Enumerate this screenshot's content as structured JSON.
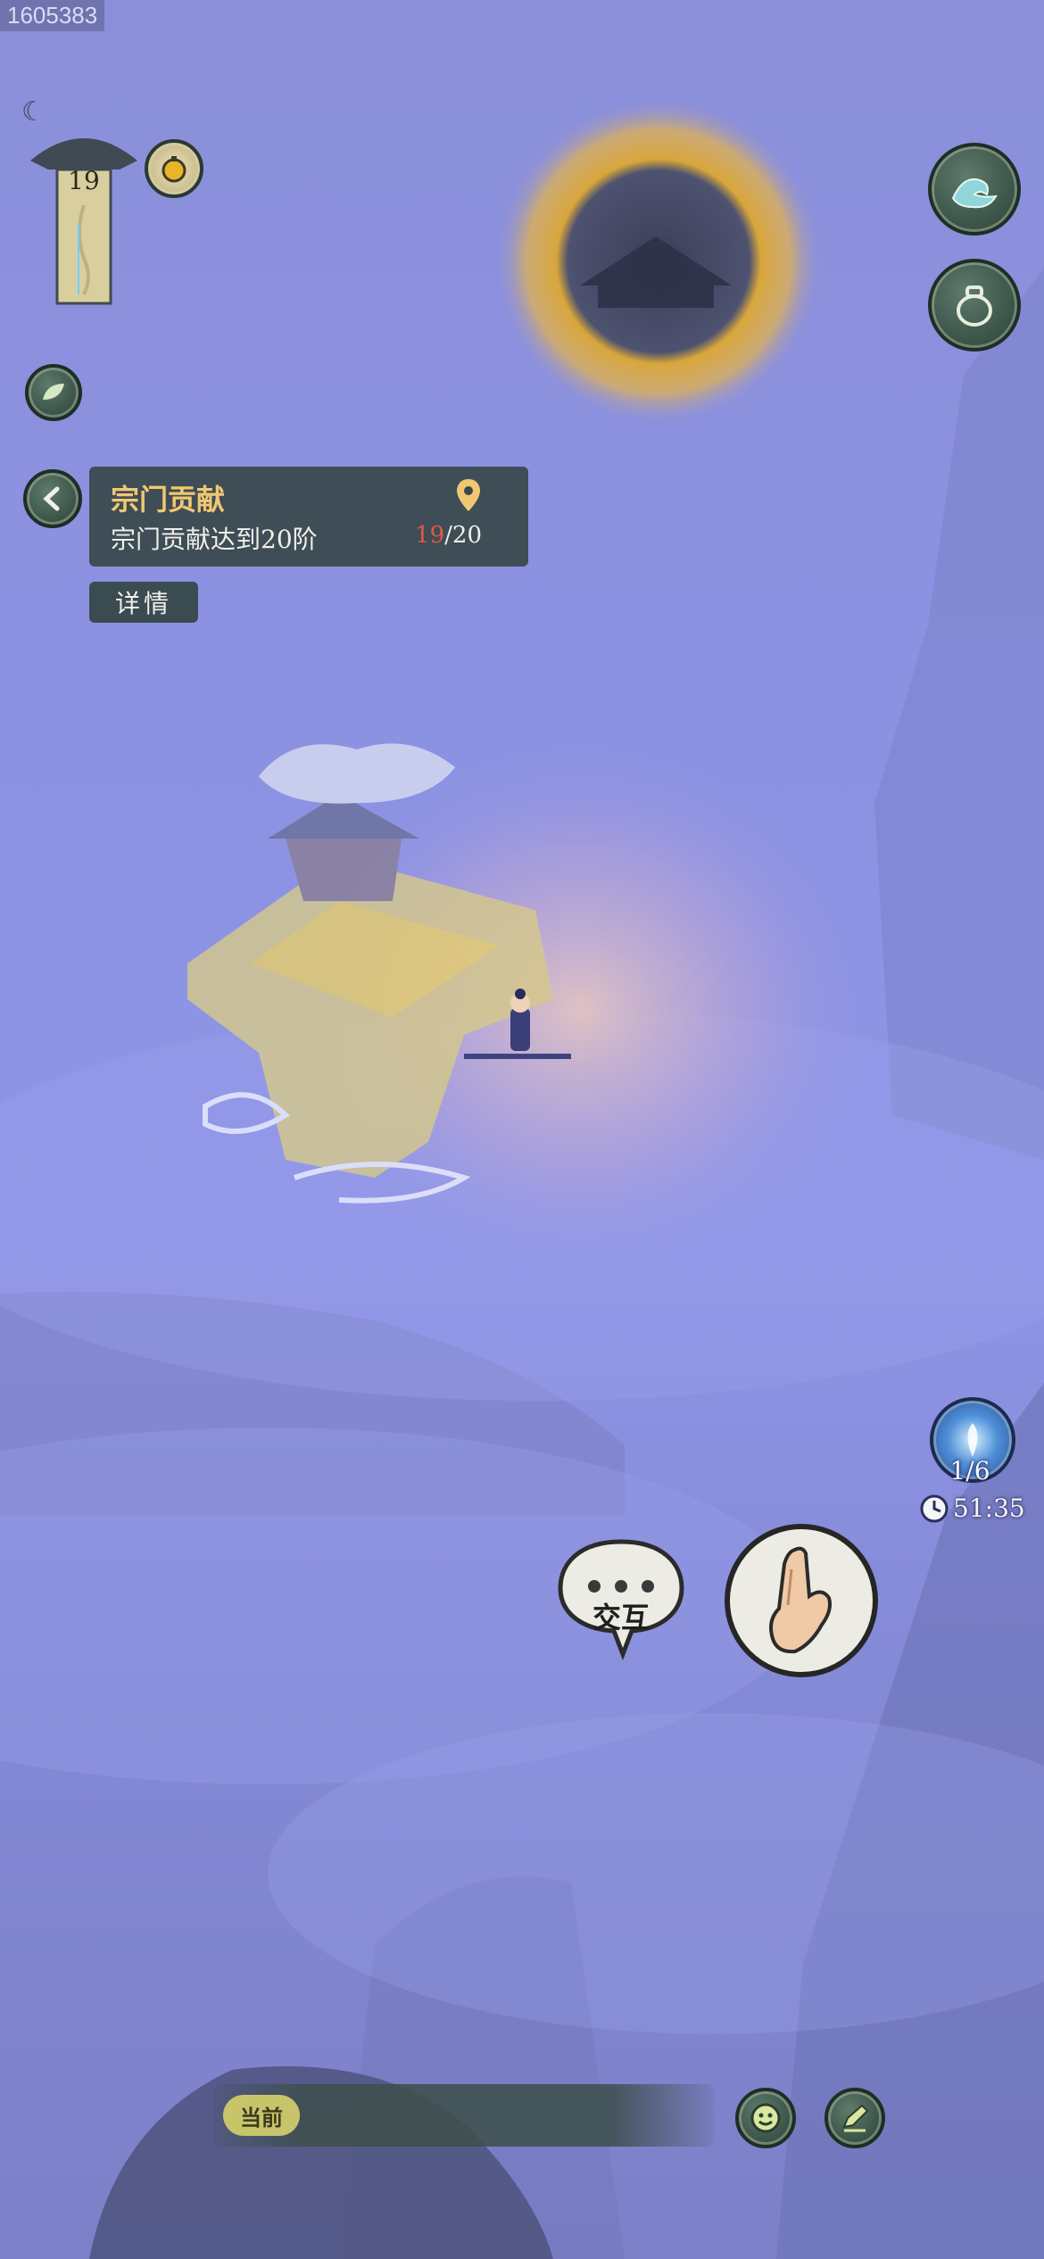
{
  "build_id": "1605383",
  "level": {
    "value": "19"
  },
  "quest": {
    "title": "宗门贡献",
    "description": "宗门贡献达到20阶",
    "progress_current": "19",
    "progress_total": "/20"
  },
  "detail_button": {
    "label": "详情"
  },
  "skill_counter": {
    "count": "1/6",
    "timer": "51:35"
  },
  "interact_button": {
    "label": "交互"
  },
  "chat_bar": {
    "current_tag": "当前"
  },
  "icons": {
    "moon": "moon-icon",
    "gourd": "gourd-icon",
    "wave": "wave-icon",
    "jar": "jar-icon",
    "leaf": "leaf-icon",
    "back": "chevron-left-icon",
    "location": "location-pin-icon",
    "clock": "clock-icon",
    "orb": "spirit-orb-icon",
    "hand": "hand-seal-icon",
    "emoji": "smile-icon",
    "edit": "edit-icon"
  },
  "colors": {
    "quest_title": "#f1c772",
    "progress_current": "#e0584a",
    "button_green": "#3d574a",
    "sky": "#8c92e2"
  }
}
